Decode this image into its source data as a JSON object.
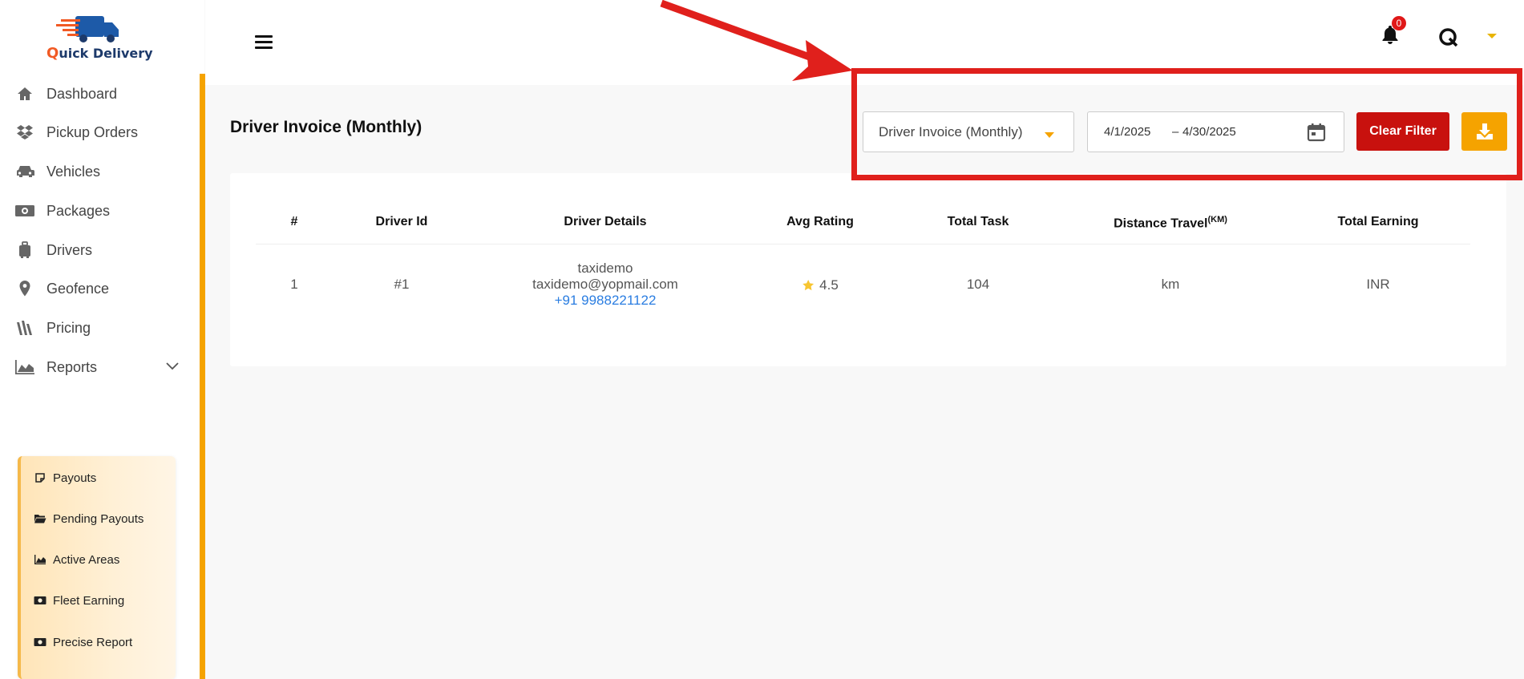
{
  "app": {
    "logo_q": "Q",
    "logo_rest": "uick Delivery"
  },
  "sidebar": {
    "items": [
      {
        "label": "Dashboard",
        "icon": "home-icon"
      },
      {
        "label": "Pickup Orders",
        "icon": "dropbox-icon"
      },
      {
        "label": "Vehicles",
        "icon": "car-icon"
      },
      {
        "label": "Packages",
        "icon": "money-icon"
      },
      {
        "label": "Drivers",
        "icon": "suitcase-icon"
      },
      {
        "label": "Geofence",
        "icon": "map-pin-icon"
      },
      {
        "label": "Pricing",
        "icon": "pricing-icon"
      },
      {
        "label": "Reports",
        "icon": "area-chart-icon"
      }
    ],
    "reports_submenu": [
      {
        "label": "Payouts",
        "icon": "sticky-note-icon"
      },
      {
        "label": "Pending Payouts",
        "icon": "folder-open-icon"
      },
      {
        "label": "Active Areas",
        "icon": "area-chart-icon"
      },
      {
        "label": "Fleet Earning",
        "icon": "money-bill-icon"
      },
      {
        "label": "Precise Report",
        "icon": "money-bill-icon"
      }
    ]
  },
  "header": {
    "notification_count": "0"
  },
  "page": {
    "title": "Driver Invoice (Monthly)"
  },
  "filters": {
    "report_type": "Driver Invoice (Monthly)",
    "date_from": "4/1/2025",
    "date_separator": "–",
    "date_to": "4/30/2025",
    "clear_filter_label": "Clear Filter"
  },
  "table": {
    "headers": {
      "index": "#",
      "driver_id": "Driver Id",
      "driver_details": "Driver Details",
      "avg_rating": "Avg Rating",
      "total_task": "Total Task",
      "distance": "Distance Travel",
      "distance_unit": "(KM)",
      "total_earning": "Total Earning"
    },
    "rows": [
      {
        "index": "1",
        "driver_id": "#1",
        "name": "taxidemo",
        "email": "taxidemo@yopmail.com",
        "phone": "+91 9988221122",
        "avg_rating": "4.5",
        "total_task": "104",
        "distance": "km",
        "total_earning": "INR"
      }
    ]
  },
  "colors": {
    "accent": "#f5a300",
    "danger": "#c8110e",
    "annotation": "#e0201c",
    "link": "#2a7de1"
  }
}
